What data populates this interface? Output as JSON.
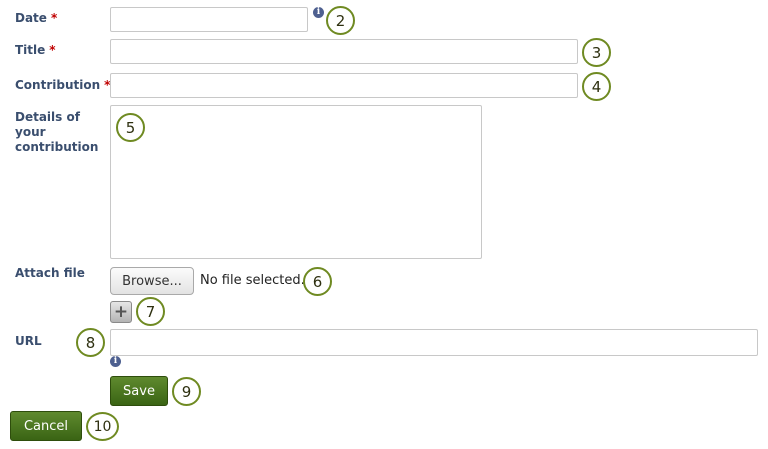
{
  "form": {
    "date_label": "Date",
    "title_label": "Title",
    "contribution_label": "Contribution",
    "details_label": "Details of your contribution",
    "attach_label": "Attach file",
    "url_label": "URL",
    "required_marker": "*",
    "date_value": "",
    "title_value": "",
    "contribution_value": "",
    "details_value": "",
    "url_value": ""
  },
  "file_input": {
    "browse_label": "Browse...",
    "status": "No file selected."
  },
  "buttons": {
    "add_symbol": "+",
    "save": "Save",
    "cancel": "Cancel"
  },
  "info_icon_glyph": "i",
  "callouts": [
    "2",
    "3",
    "4",
    "5",
    "6",
    "7",
    "8",
    "9",
    "10"
  ],
  "colors": {
    "label_text": "#3a4e6e",
    "required": "#c00000",
    "callout_border": "#6f8a22",
    "button_green": "#3a6414"
  }
}
